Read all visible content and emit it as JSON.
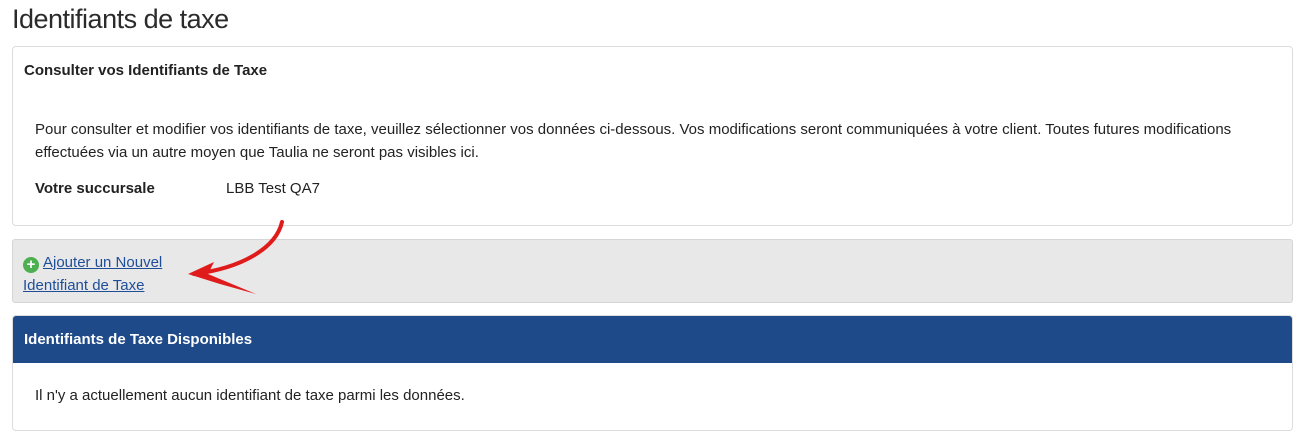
{
  "page": {
    "title": "Identifiants de taxe"
  },
  "consult_card": {
    "title": "Consulter vos Identifiants de Taxe",
    "description": "Pour consulter et modifier vos identifiants de taxe, veuillez sélectionner vos données ci-dessous. Vos modifications seront communiquées à votre client. Toutes futures modifications effectuées via un autre moyen que Taulia ne seront pas visibles ici.",
    "branch_label": "Votre succursale",
    "branch_value": "LBB Test QA7"
  },
  "actions": {
    "add_icon": "plus-circle-icon",
    "add_link_label": "Ajouter un Nouvel Identifiant de Taxe",
    "annotation": "red-arrow-icon"
  },
  "available_panel": {
    "title": "Identifiants de Taxe Disponibles",
    "empty_message": "Il n'y a actuellement aucun identifiant de taxe parmi les données."
  },
  "colors": {
    "header_blue": "#1e4a8a",
    "link_blue": "#1f4e99",
    "add_green": "#4caf50",
    "arrow_red": "#e01b1b",
    "action_bar_bg": "#e8e8e8"
  }
}
